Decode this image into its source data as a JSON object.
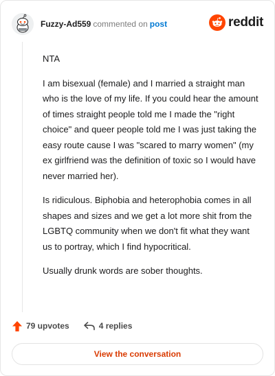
{
  "header": {
    "username": "Fuzzy-Ad559",
    "action_text": "commented on",
    "post_link": "post",
    "brand": "reddit"
  },
  "comment": {
    "paragraphs": [
      "NTA",
      "I am bisexual (female) and I married a straight man who is the love of my life. If you could hear the amount of times straight people told me I made the \"right choice\" and queer people told me I was just taking the easy route cause I was \"scared to marry women\" (my ex girlfriend was the definition of toxic so I would have never married her).",
      "Is ridiculous. Biphobia and heterophobia comes in all shapes and sizes and we get a lot more shit from the LGBTQ community when we don't fit what they want us to portray, which I find hypocritical.",
      "Usually drunk words are sober thoughts."
    ]
  },
  "stats": {
    "upvotes": "79 upvotes",
    "replies": "4 replies"
  },
  "footer": {
    "view_button": "View the conversation"
  },
  "colors": {
    "accent": "#ff4500",
    "link": "#0079d3",
    "button_text": "#d93a00"
  }
}
